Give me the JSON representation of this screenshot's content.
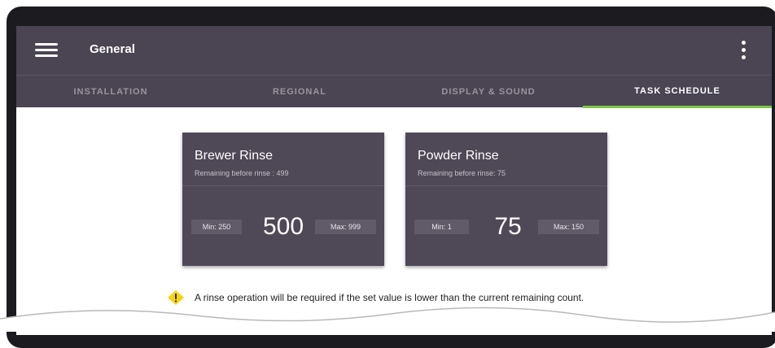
{
  "header": {
    "title": "General",
    "menu_icon": "hamburger-menu-icon",
    "more_icon": "more-vertical-icon"
  },
  "tabs": [
    {
      "label": "INSTALLATION",
      "active": false
    },
    {
      "label": "REGIONAL",
      "active": false
    },
    {
      "label": "DISPLAY & SOUND",
      "active": false
    },
    {
      "label": "TASK SCHEDULE",
      "active": true
    }
  ],
  "cards": [
    {
      "title": "Brewer Rinse",
      "subtitle": "Remaining before rinse : 499",
      "min": "Min: 250",
      "value": "500",
      "max": "Max: 999"
    },
    {
      "title": "Powder Rinse",
      "subtitle": "Remaining before rinse: 75",
      "min": "Min: 1",
      "value": "75",
      "max": "Max: 150"
    }
  ],
  "note": {
    "icon": "warning-icon",
    "text": "A rinse operation will be required if the set value is lower than the current remaining count."
  },
  "colors": {
    "header_bg": "#4a4453",
    "card_bg": "#4f4857",
    "active_tab_underline": "#7ac943",
    "warning": "#f5d410"
  }
}
